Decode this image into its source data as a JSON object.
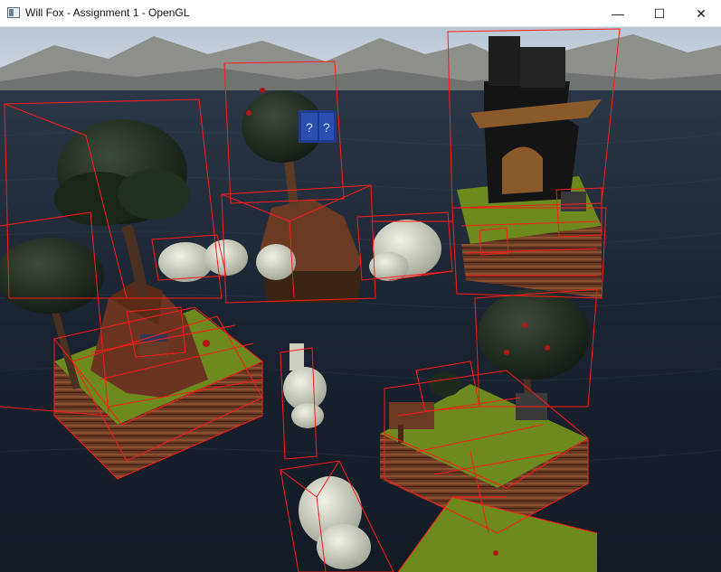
{
  "window": {
    "title": "Will Fox - Assignment 1 - OpenGL",
    "controls": {
      "minimize": "—",
      "maximize": "☐",
      "close": "✕"
    }
  },
  "scene": {
    "description_icon": "opengl-window-icon",
    "colors": {
      "sky": "#c9d3de",
      "water": "#1a2430",
      "bounding_box": "#ff1a1a",
      "grass": "#6e8a1e",
      "dirt": "#6b3a24",
      "trunk": "#5a3a22",
      "foliage": "#1f2a1f",
      "rock": "#cfcfbf",
      "tower": "#141414"
    }
  }
}
